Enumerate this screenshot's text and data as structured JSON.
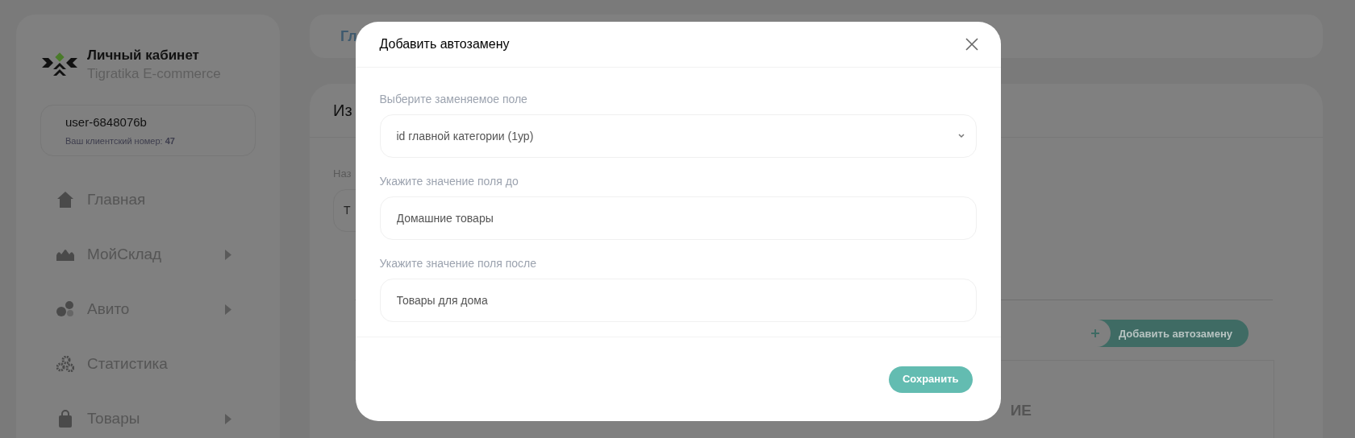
{
  "sidebar": {
    "brand": {
      "title": "Личный кабинет",
      "subtitle": "Tigratika E-commerce"
    },
    "account": {
      "username": "user-6848076b",
      "client_number": "Ваш клиентский номер: **47**"
    },
    "nav": [
      {
        "kind": "home",
        "label": "Главная",
        "has_submenu": false
      },
      {
        "kind": "warehouse",
        "label": "МойСклад",
        "has_submenu": true
      },
      {
        "kind": "avito",
        "label": "Авито",
        "has_submenu": true
      },
      {
        "kind": "stats",
        "label": "Статистика",
        "has_submenu": false
      },
      {
        "kind": "goods",
        "label": "Товары",
        "has_submenu": true
      }
    ]
  },
  "background": {
    "breadcrumb": "Гл",
    "page_title": "Из",
    "field_label": "Наз",
    "field_value": "Т",
    "add_button": "Добавить автозамену",
    "section_heading": "ИЕ"
  },
  "modal": {
    "title": "Добавить автозамену",
    "fields": [
      {
        "kind": "select",
        "label": "Выберите заменяемое поле",
        "value": "id главной категории (1ур)"
      },
      {
        "kind": "input",
        "label": "Укажите значение поля до",
        "value": "Домашние товары"
      },
      {
        "kind": "input",
        "label": "Укажите значение поля после",
        "value": "Товары для дома"
      }
    ],
    "save_button": "Сохранить"
  }
}
